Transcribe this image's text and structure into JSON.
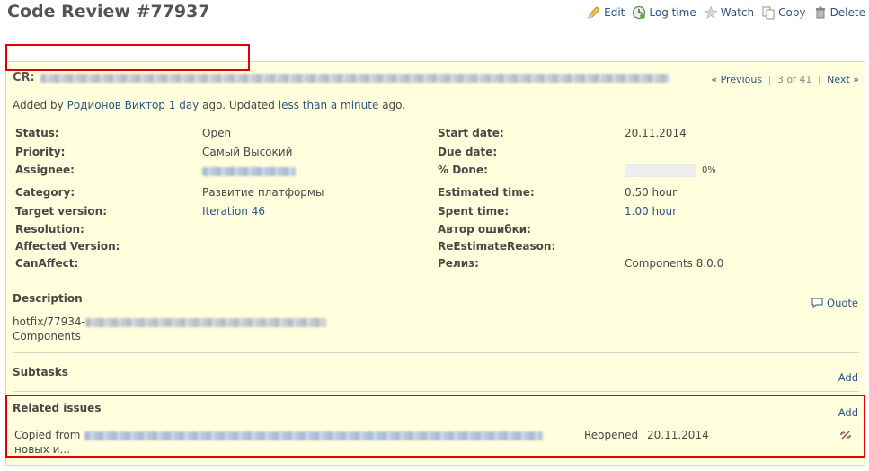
{
  "header": {
    "title": "Code Review #77937",
    "actions": [
      {
        "label": "Edit",
        "icon": "pencil-icon"
      },
      {
        "label": "Log time",
        "icon": "clock-icon"
      },
      {
        "label": "Watch",
        "icon": "star-icon"
      },
      {
        "label": "Copy",
        "icon": "copy-icon"
      },
      {
        "label": "Delete",
        "icon": "trash-icon"
      }
    ]
  },
  "issue": {
    "subject_prefix": "CR:",
    "nav": {
      "previous": "« Previous",
      "position": "3 of 41",
      "next": "Next »"
    },
    "author_line": {
      "added_by": "Added by",
      "author": "Родионов Виктор",
      "added_ago": "1 day",
      "ago1": "ago. Updated",
      "updated_ago": "less than a minute",
      "ago2": "ago."
    },
    "attributes_left": [
      {
        "label": "Status:",
        "value": ""
      },
      {
        "label": "Priority:",
        "value": ""
      },
      {
        "label": "Assignee:",
        "value": ""
      },
      {
        "label": "Category:",
        "value": ""
      },
      {
        "label": "Target version:",
        "value": ""
      },
      {
        "label": "Resolution:",
        "value": ""
      },
      {
        "label": "Affected Version:",
        "value": ""
      },
      {
        "label": "CanAffect:",
        "value": ""
      }
    ],
    "status": "Open",
    "priority": "Самый Высокий",
    "category": "Развитие платформы",
    "target_version": "Iteration 46",
    "attributes_right": [
      {
        "label": "Start date:",
        "value": "20.11.2014"
      },
      {
        "label": "Due date:",
        "value": ""
      },
      {
        "label": "% Done:",
        "value": "0%"
      },
      {
        "label": "Estimated time:",
        "value": "0.50 hour"
      },
      {
        "label": "Spent time:",
        "value": "1.00 hour"
      },
      {
        "label": "Автор ошибки:",
        "value": ""
      },
      {
        "label": "ReEstimateReason:",
        "value": ""
      },
      {
        "label": "Релиз:",
        "value": "Components 8.0.0"
      }
    ],
    "done_percent": 0,
    "description": {
      "title": "Description",
      "quote": "Quote",
      "line1_prefix": "hotfix/77934-",
      "line2": "Components"
    },
    "subtasks": {
      "title": "Subtasks",
      "add": "Add"
    },
    "related": {
      "title": "Related issues",
      "add": "Add",
      "row": {
        "relation": "Copied from",
        "suffix": "новых и...",
        "status": "Reopened",
        "date": "20.11.2014"
      }
    }
  },
  "colors": {
    "issue_bg": "#ffffdd",
    "link": "#2a5685",
    "annotation": "#e30000"
  }
}
